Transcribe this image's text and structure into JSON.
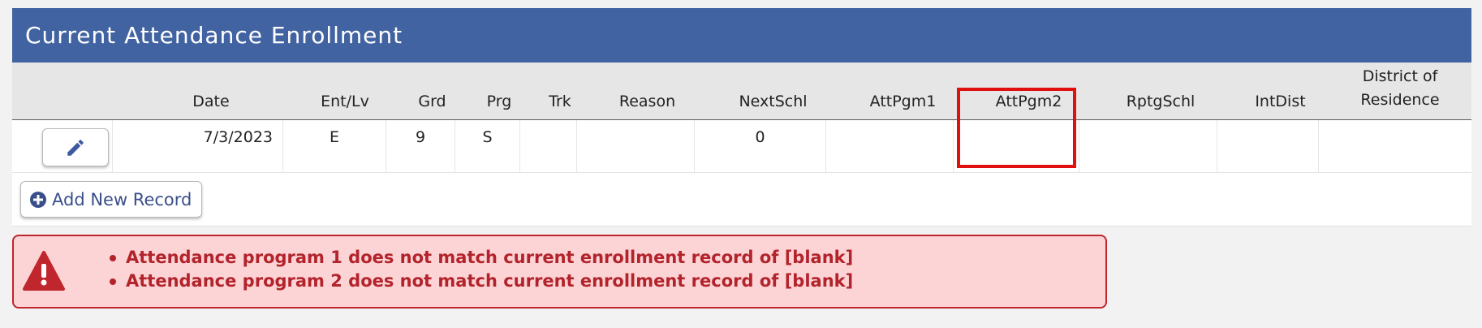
{
  "panel": {
    "title": "Current Attendance Enrollment"
  },
  "columns": {
    "date": "Date",
    "entlv": "Ent/Lv",
    "grd": "Grd",
    "prg": "Prg",
    "trk": "Trk",
    "reason": "Reason",
    "nextschl": "NextSchl",
    "attpgm1": "AttPgm1",
    "attpgm2": "AttPgm2",
    "rptgschl": "RptgSchl",
    "intdist": "IntDist",
    "district_line1": "District of",
    "district_line2": "Residence"
  },
  "row": {
    "date": "7/3/2023",
    "entlv": "E",
    "grd": "9",
    "prg": "S",
    "trk": "",
    "reason": "",
    "nextschl": "0",
    "attpgm1": "",
    "attpgm2": "",
    "rptgschl": "",
    "intdist": "",
    "district": ""
  },
  "icons": {
    "edit": "pencil-icon",
    "add": "plus-circle-icon",
    "warning": "warning-triangle-icon"
  },
  "add_button": {
    "label": "Add New Record"
  },
  "alert": {
    "messages": [
      "Attendance program 1 does not match current enrollment record of [blank]",
      "Attendance program 2 does not match current enrollment record of [blank]"
    ]
  },
  "colors": {
    "header": "#4263a1",
    "alert_bg": "#fdd4d6",
    "alert_text": "#b2232b",
    "highlight": "#e01010"
  }
}
